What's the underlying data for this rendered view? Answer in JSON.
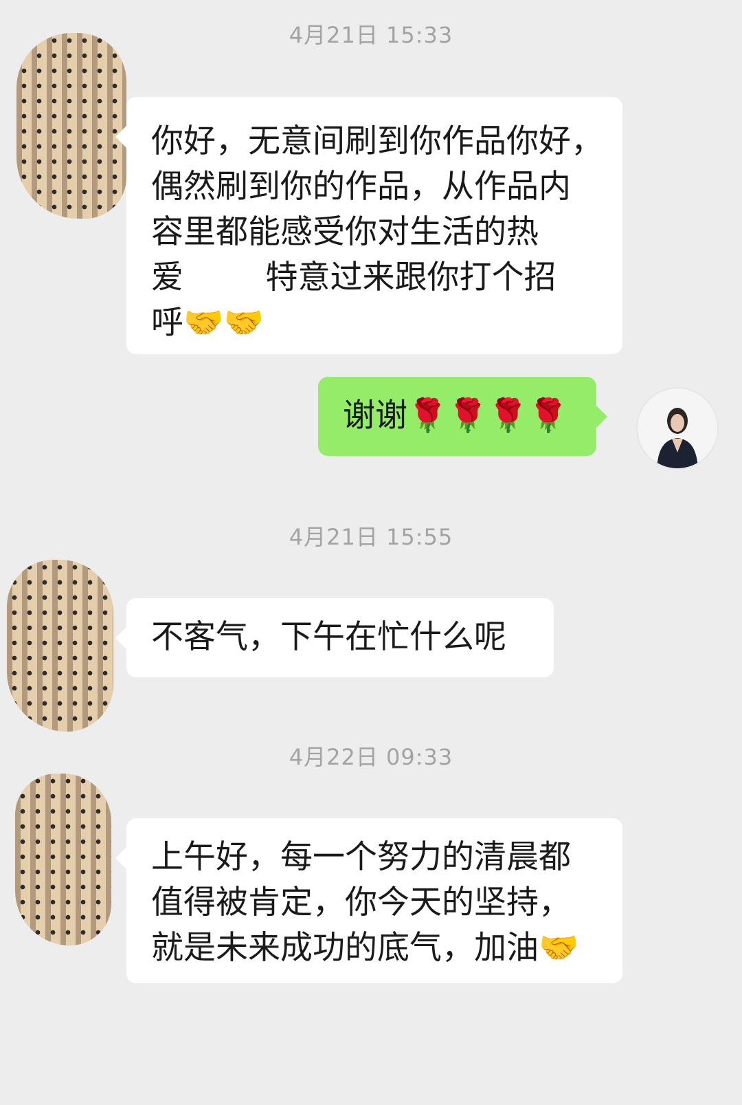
{
  "chat": {
    "timestamps": [
      "4月21日 15:33",
      "4月21日 15:55",
      "4月22日 09:33"
    ],
    "messages": [
      {
        "sender": "other",
        "lines": [
          "你好，无意间刷到你作品你好，",
          "偶然刷到你的作品，从作品内",
          "容里都能感受你对生活的热",
          "爱        特意过来跟你打个招",
          "呼🤝🤝"
        ]
      },
      {
        "sender": "self",
        "lines": [
          "谢谢🌹🌹🌹🌹"
        ]
      },
      {
        "sender": "other",
        "lines": [
          "不客气，下午在忙什么呢"
        ]
      },
      {
        "sender": "other",
        "lines": [
          "上午好，每一个努力的清晨都",
          "值得被肯定，你今天的坚持，",
          "就是未来成功的底气，加油🤝"
        ]
      }
    ]
  }
}
